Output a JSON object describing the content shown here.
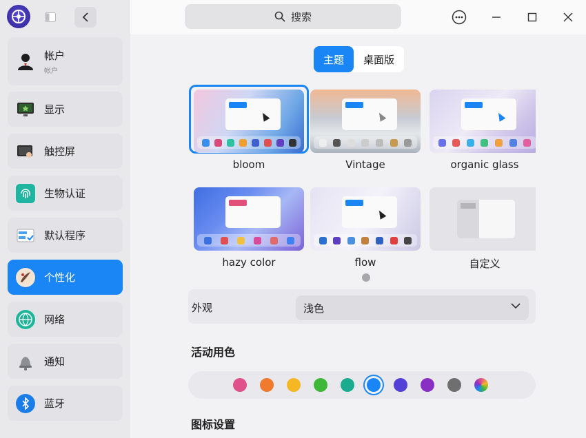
{
  "titlebar": {
    "search_label": "搜索"
  },
  "sidebar": {
    "items": [
      {
        "label": "帐户",
        "sub": "帐户",
        "icon": "user-account-icon"
      },
      {
        "label": "显示",
        "icon": "display-icon"
      },
      {
        "label": "触控屏",
        "icon": "touchscreen-icon"
      },
      {
        "label": "生物认证",
        "icon": "fingerprint-icon"
      },
      {
        "label": "默认程序",
        "icon": "default-apps-icon"
      },
      {
        "label": "个性化",
        "icon": "personalization-icon"
      },
      {
        "label": "网络",
        "icon": "network-icon"
      },
      {
        "label": "通知",
        "icon": "bell-icon"
      },
      {
        "label": "蓝牙",
        "icon": "bluetooth-icon"
      }
    ]
  },
  "main": {
    "tabs": [
      {
        "label": "主题",
        "selected": true
      },
      {
        "label": "桌面版",
        "selected": false
      }
    ],
    "themes": [
      {
        "name": "bloom",
        "selected": true
      },
      {
        "name": "Vintage",
        "selected": false
      },
      {
        "name": "organic glass",
        "selected": false
      },
      {
        "name": "hazy color",
        "selected": false
      },
      {
        "name": "flow",
        "selected": false
      },
      {
        "name": "自定义",
        "selected": false
      }
    ],
    "appearance": {
      "label": "外观",
      "value": "浅色"
    },
    "accent_section_title": "活动用色",
    "accent_colors": [
      "#e0508a",
      "#f07a2e",
      "#f5b824",
      "#3fb83a",
      "#1bab8e",
      "#1a86f5",
      "#5340d6",
      "#8a2fc4",
      "#6f6f6f",
      "multicolor"
    ],
    "selected_accent": "#1a86f5",
    "icon_section_title": "图标设置"
  }
}
